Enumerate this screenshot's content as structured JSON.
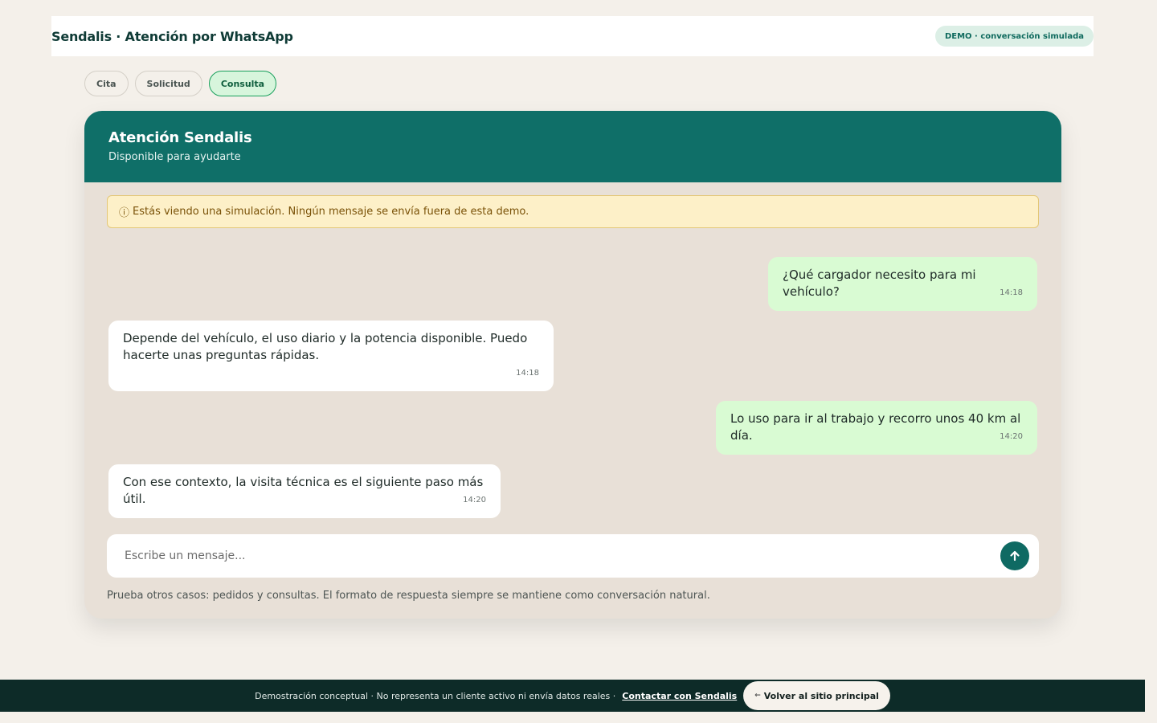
{
  "header": {
    "title": "Sendalis · Atención por WhatsApp",
    "badge": "DEMO · conversación simulada"
  },
  "tabs": [
    {
      "label": "Cita",
      "active": false
    },
    {
      "label": "Solicitud",
      "active": false
    },
    {
      "label": "Consulta",
      "active": true
    }
  ],
  "chat": {
    "title": "Atención Sendalis",
    "subtitle": "Disponible para ayudarte",
    "notice_icon": "ⓘ",
    "notice": "Estás viendo una simulación. Ningún mensaje se envía fuera de esta demo.",
    "messages": [
      {
        "direction": "out",
        "text": "¿Qué cargador necesito para mi vehículo?",
        "time": "14:18"
      },
      {
        "direction": "in",
        "text": "Depende del vehículo, el uso diario y la potencia disponible. Puedo hacerte unas preguntas rápidas.",
        "time": "14:18"
      },
      {
        "direction": "out",
        "text": "Lo uso para ir al trabajo y recorro unos 40 km al día.",
        "time": "14:20"
      },
      {
        "direction": "in",
        "text": "Con ese contexto, la visita técnica es el siguiente paso más útil.",
        "time": "14:20"
      }
    ],
    "composer_placeholder": "Escribe un mensaje...",
    "send_icon": "arrow-up-icon",
    "hint": "Prueba otros casos: pedidos y consultas. El formato de respuesta siempre se mantiene como conversación natural."
  },
  "footer": {
    "disclaimer": "Demostración conceptual · No representa un cliente activo ni envía datos reales ·",
    "contact_link": "Contactar con Sendalis",
    "back_arrow": "←",
    "back_button": "Volver al sitio principal"
  },
  "colors": {
    "page_bg": "#f4f0ea",
    "brand_teal": "#0f6f68",
    "outgoing_bubble": "#d9fbd3",
    "incoming_bubble": "#ffffff",
    "notice_bg": "#fdf0c8",
    "footer_bg": "#0d2b28"
  }
}
